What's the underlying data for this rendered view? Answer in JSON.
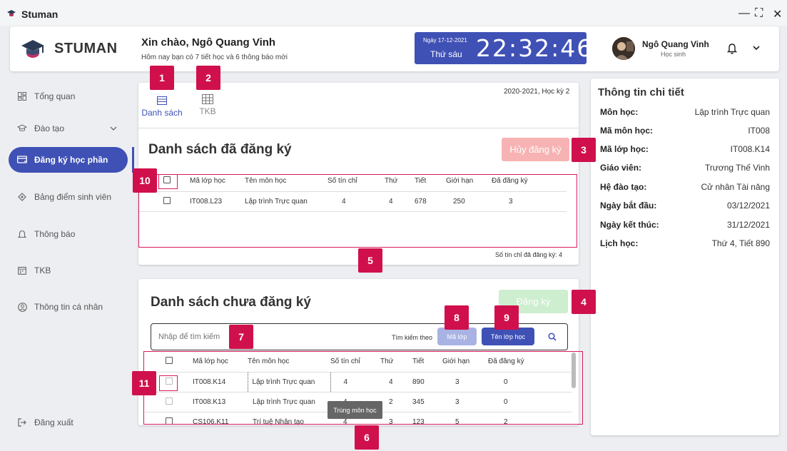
{
  "app": {
    "title": "Stuman",
    "brand": "STUMAN"
  },
  "window_controls": {
    "minimize": "—",
    "maximize": "⛶",
    "close": "✕"
  },
  "header": {
    "greeting": "Xin chào, Ngô Quang Vinh",
    "subtitle": "Hôm nay bạn có 7 tiết học và 6 thông báo mới",
    "clock": {
      "date": "Ngày 17-12-2021",
      "weekday": "Thứ sáu",
      "time": "22:32:46"
    },
    "user": {
      "name": "Ngô Quang Vinh",
      "role": "Học sinh"
    },
    "icons": [
      "bell-icon",
      "chevron-down-icon"
    ]
  },
  "sidebar": {
    "items": [
      {
        "label": "Tổng quan",
        "icon": "dashboard-icon"
      },
      {
        "label": "Đào tạo",
        "icon": "graduation-cap-icon",
        "has_chevron": true
      },
      {
        "label": "Đăng ký học phần",
        "icon": "register-card-icon",
        "active": true
      },
      {
        "label": "Bảng điểm sinh viên",
        "icon": "grade-icon"
      },
      {
        "label": "Thông báo",
        "icon": "bell-icon"
      },
      {
        "label": "TKB",
        "icon": "calendar-icon"
      },
      {
        "label": "Thông tin cá nhân",
        "icon": "person-icon"
      }
    ],
    "logout": "Đăng xuất"
  },
  "registered": {
    "tabs": [
      {
        "label": "Danh sách",
        "active": true
      },
      {
        "label": "TKB"
      }
    ],
    "term": "2020-2021, Học kỳ 2",
    "title": "Danh sách đã đăng ký",
    "cancel_button": "Hủy đăng ký",
    "columns": [
      "Mã lớp học",
      "Tên môn học",
      "Số tín chỉ",
      "Thứ",
      "Tiết",
      "Giới hạn",
      "Đã đăng ký"
    ],
    "rows": [
      [
        "IT008.L23",
        "Lập trình Trực quan",
        "4",
        "4",
        "678",
        "250",
        "3"
      ]
    ],
    "total_credits": "Số tín chỉ đã đăng ký:  4"
  },
  "unregistered": {
    "title": "Danh sách chưa đăng ký",
    "register_button": "Đăng ký",
    "search": {
      "placeholder": "Nhập để tìm kiếm",
      "by_label": "Tìm kiếm theo",
      "option_class_code": "Mã lớp",
      "option_class_name": "Tên lớp học"
    },
    "columns": [
      "Mã lớp học",
      "Tên môn học",
      "Số tín chỉ",
      "Thứ",
      "Tiết",
      "Giới hạn",
      "Đã đăng ký"
    ],
    "rows": [
      [
        "IT008.K14",
        "Lập trình Trực quan",
        "4",
        "4",
        "890",
        "3",
        "0"
      ],
      [
        "IT008.K13",
        "Lập trình Trực quan",
        "4",
        "2",
        "345",
        "3",
        "0"
      ],
      [
        "CS106.K11",
        "Trí tuệ Nhân tạo",
        "4",
        "3",
        "123",
        "5",
        "2"
      ]
    ],
    "tooltip": "Trùng môn học"
  },
  "detail": {
    "title": "Thông tin chi tiết",
    "fields": [
      {
        "key": "Môn học:",
        "value": "Lập trình Trực quan"
      },
      {
        "key": "Mã môn học:",
        "value": "IT008"
      },
      {
        "key": "Mã lớp học:",
        "value": "IT008.K14"
      },
      {
        "key": "Giáo viên:",
        "value": "Trương Thế Vinh"
      },
      {
        "key": "Hệ đào tạo:",
        "value": "Cử nhân Tài năng"
      },
      {
        "key": "Ngày bắt đầu:",
        "value": "03/12/2021"
      },
      {
        "key": "Ngày kết thúc:",
        "value": "31/12/2021"
      },
      {
        "key": "Lịch học:",
        "value": "Thứ 4, Tiết 890"
      }
    ]
  },
  "annotations": [
    "1",
    "2",
    "3",
    "4",
    "5",
    "6",
    "7",
    "8",
    "9",
    "10",
    "11"
  ],
  "colors": {
    "primary": "#3f51b5",
    "annotation": "#d0104c",
    "cancel": "#f7b3b3",
    "register": "#cdeecf"
  }
}
